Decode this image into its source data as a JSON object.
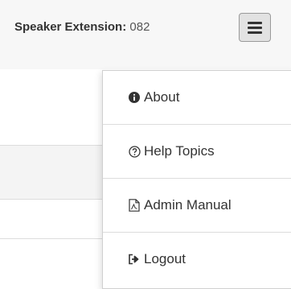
{
  "header": {
    "extension_label": "Speaker Extension:",
    "extension_value": "082"
  },
  "menu": {
    "items": [
      {
        "label": "About",
        "icon": "info-circle-icon"
      },
      {
        "label": "Help Topics",
        "icon": "question-circle-icon"
      },
      {
        "label": "Admin Manual",
        "icon": "pdf-file-icon"
      },
      {
        "label": "Logout",
        "icon": "sign-out-icon"
      }
    ]
  }
}
